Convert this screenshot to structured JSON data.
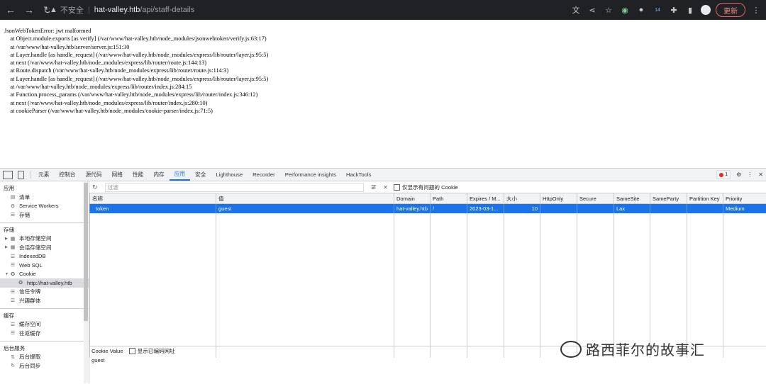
{
  "browser": {
    "insecure_label": "不安全",
    "url_host": "hat-valley.htb",
    "url_path": "/api/staff-details",
    "update_label": "更新",
    "extension_badge": "14"
  },
  "page": {
    "lines": [
      "JsonWebTokenError: jwt malformed",
      "    at Object.module.exports [as verify] (/var/www/hat-valley.htb/node_modules/jsonwebtoken/verify.js:63:17)",
      "    at /var/www/hat-valley.htb/server/server.js:151:30",
      "    at Layer.handle [as handle_request] (/var/www/hat-valley.htb/node_modules/express/lib/router/layer.js:95:5)",
      "    at next (/var/www/hat-valley.htb/node_modules/express/lib/router/route.js:144:13)",
      "    at Route.dispatch (/var/www/hat-valley.htb/node_modules/express/lib/router/route.js:114:3)",
      "    at Layer.handle [as handle_request] (/var/www/hat-valley.htb/node_modules/express/lib/router/layer.js:95:5)",
      "    at /var/www/hat-valley.htb/node_modules/express/lib/router/index.js:284:15",
      "    at Function.process_params (/var/www/hat-valley.htb/node_modules/express/lib/router/index.js:346:12)",
      "    at next (/var/www/hat-valley.htb/node_modules/express/lib/router/index.js:280:10)",
      "    at cookieParser (/var/www/hat-valley.htb/node_modules/cookie-parser/index.js:71:5)"
    ]
  },
  "devtools": {
    "tabs": [
      "元素",
      "控制台",
      "源代码",
      "网络",
      "性能",
      "内存",
      "应用",
      "安全",
      "Lighthouse",
      "Recorder",
      "Performance insights",
      "HackTools"
    ],
    "active_tab": "应用",
    "error_count": "1",
    "sidebar": {
      "app_head": "应用",
      "app_items": [
        "清单",
        "Service Workers",
        "存储"
      ],
      "storage_head": "存储",
      "storage_items": [
        "本地存储空间",
        "会话存储空间",
        "IndexedDB",
        "Web SQL",
        "Cookie"
      ],
      "cookie_origin": "http://hat-valley.htb",
      "storage_items2": [
        "信任令牌",
        "兴趣群体"
      ],
      "cache_head": "缓存",
      "cache_items": [
        "缓存空间",
        "往返缓存"
      ],
      "bg_head": "后台服务",
      "bg_items": [
        "后台提取",
        "后台同步"
      ]
    },
    "toolbar": {
      "filter_placeholder": "过滤",
      "only_issues_label": "仅显示有问题的 Cookie"
    },
    "table": {
      "headers": [
        "名称",
        "值",
        "Domain",
        "Path",
        "Expires / M...",
        "大小",
        "HttpOnly",
        "Secure",
        "SameSite",
        "SameParty",
        "Partition Key",
        "Priority"
      ],
      "rows": [
        [
          "token",
          "guest",
          "hat-valley.htb",
          "/",
          "2023-03-1...",
          "10",
          "",
          "",
          "Lax",
          "",
          "",
          "Medium"
        ]
      ]
    },
    "cookie_value": {
      "label": "Cookie Value",
      "decode_label": "显示已编码网址",
      "value": "guest"
    }
  },
  "watermark": "路西菲尔的故事汇"
}
